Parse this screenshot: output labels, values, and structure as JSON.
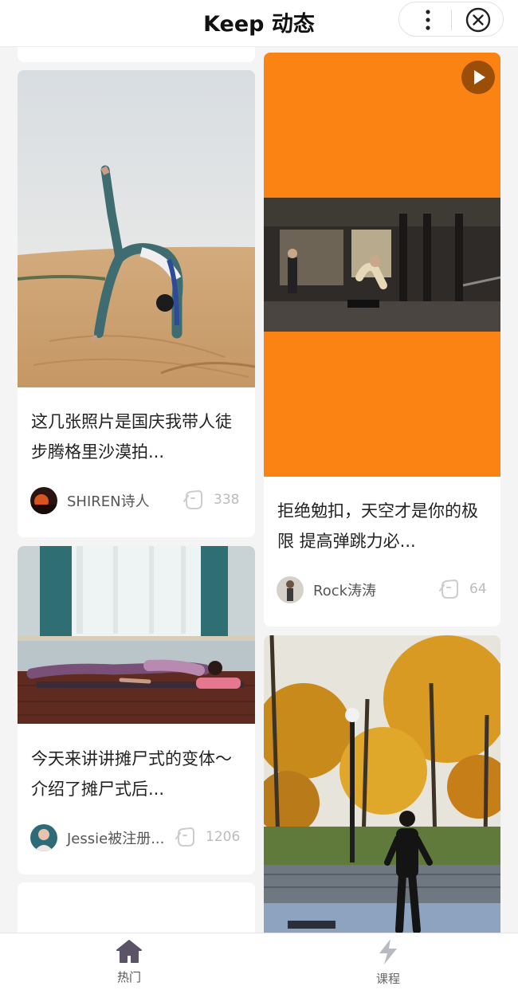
{
  "header": {
    "title": "Keep 动态",
    "more_icon": "more-vertical-icon",
    "close_icon": "close-circle-icon"
  },
  "feed": {
    "left": [
      {
        "title": "这几张照片是国庆我带人徒步腾格里沙漠拍...",
        "author": "SHIREN诗人",
        "likes": "338",
        "image": "desert-yoga-backbend-photo",
        "avatar": "sunset-avatar"
      },
      {
        "title": "今天来讲讲摊尸式的变体～ 介绍了摊尸式后...",
        "author": "Jessie被注册...",
        "likes": "1206",
        "image": "room-yoga-lying-photo",
        "avatar": "woman-avatar"
      }
    ],
    "right": [
      {
        "title": "拒绝勉扣，天空才是你的极限 提高弹跳力必...",
        "author": "Rock涛涛",
        "likes": "64",
        "image": "gym-jump-video",
        "avatar": "man-avatar",
        "video_bg": "#fb8313",
        "has_play": true
      },
      {
        "image": "ginkgo-park-running-photo"
      }
    ]
  },
  "tabs": [
    {
      "label": "热门",
      "icon": "home-icon",
      "active": true
    },
    {
      "label": "课程",
      "icon": "lightning-icon",
      "active": false
    }
  ],
  "colors": {
    "accent_orange": "#fb8313",
    "tab_active": "#5a5466",
    "tab_inactive": "#b9b9c1"
  }
}
